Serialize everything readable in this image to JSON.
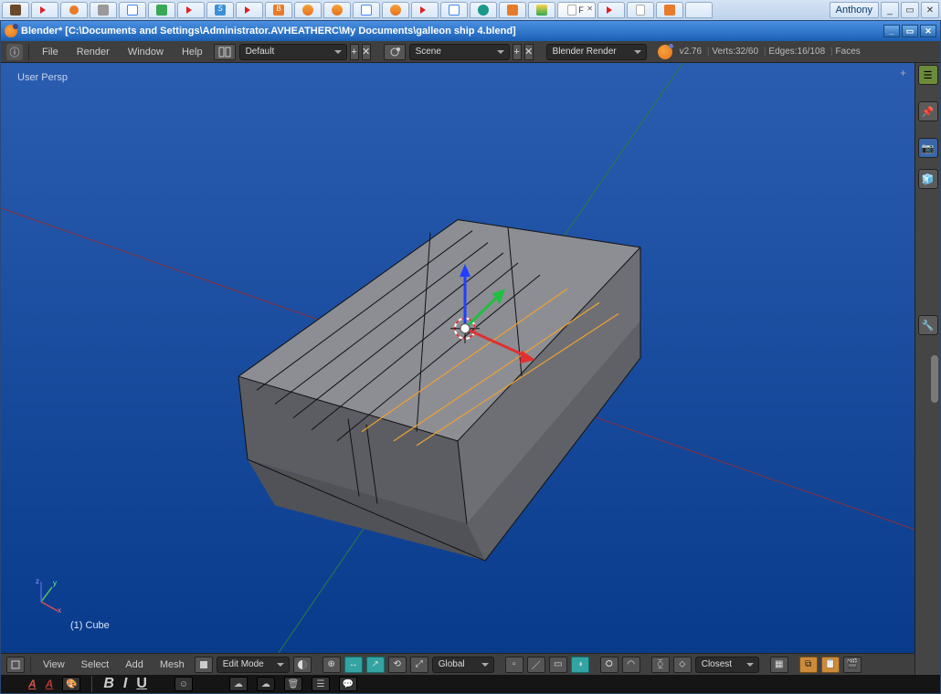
{
  "os": {
    "user": "Anthony",
    "tabs": [
      "book",
      "yt",
      "pin",
      "cube",
      "google",
      "green",
      "yt",
      "blue",
      "yt",
      "orange",
      "blender",
      "blender",
      "google",
      "blender",
      "yt",
      "google",
      "teal",
      "orange",
      "drive",
      "doc",
      "yt",
      "doc",
      "orange",
      "blank"
    ],
    "active_tab_index": 19,
    "active_tab_text": "F"
  },
  "window": {
    "title": "Blender* [C:\\Documents and Settings\\Administrator.AVHEATHERC\\My Documents\\galleon ship 4.blend]"
  },
  "topbar": {
    "menus": [
      "File",
      "Render",
      "Window",
      "Help"
    ],
    "screen_layout": "Default",
    "scene": "Scene",
    "renderer": "Blender Render",
    "version": "v2.76",
    "stats": {
      "verts": "32/60",
      "edges": "16/108",
      "faces_label": "Faces"
    }
  },
  "viewport": {
    "label": "User Persp",
    "object_label": "(1) Cube",
    "axis": {
      "x": "x",
      "y": "y",
      "z": "z"
    }
  },
  "vp_header": {
    "menus": [
      "View",
      "Select",
      "Add",
      "Mesh"
    ],
    "mode": "Edit Mode",
    "orientation": "Global",
    "snap_target": "Closest"
  },
  "timeline": {
    "a1": "A",
    "a2": "A",
    "b": "B",
    "i": "I",
    "u": "U"
  }
}
